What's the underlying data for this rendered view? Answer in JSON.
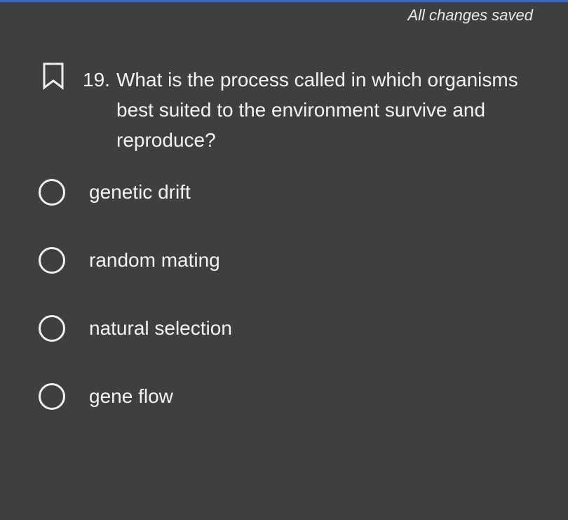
{
  "status": {
    "save_text": "All changes saved"
  },
  "question": {
    "number": "19.",
    "text": "What is the process called in which organisms best suited to the environment survive and reproduce?",
    "bookmark_icon": "bookmark-outline-icon"
  },
  "options": [
    {
      "label": "genetic drift",
      "selected": false
    },
    {
      "label": "random mating",
      "selected": false
    },
    {
      "label": "natural selection",
      "selected": false
    },
    {
      "label": "gene flow",
      "selected": false
    }
  ],
  "colors": {
    "background": "#3f3f3f",
    "accent_bar": "#3a67c4",
    "text": "#f2f2f2"
  }
}
